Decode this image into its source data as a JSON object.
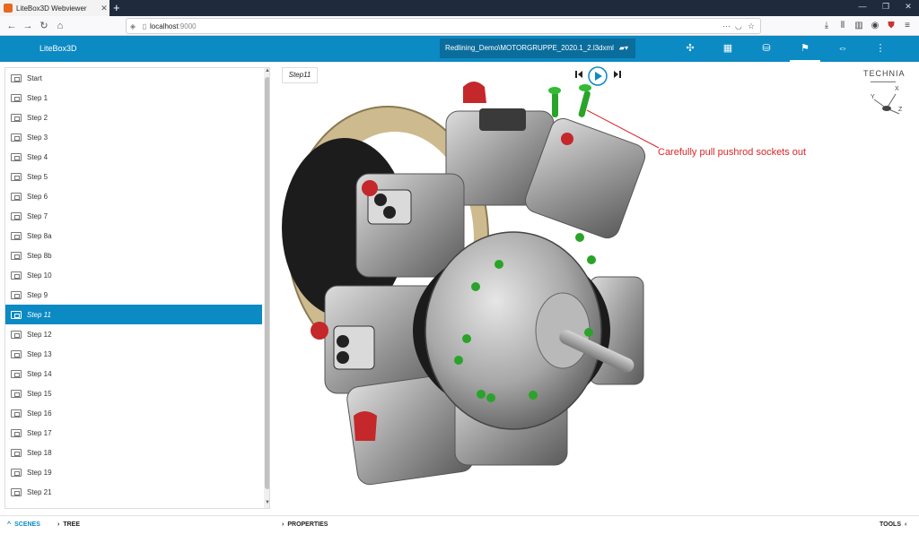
{
  "browser": {
    "tab_title": "LiteBox3D Webviewer",
    "url_host": "localhost",
    "url_port": ":9000"
  },
  "app": {
    "brand": "LiteBox3D",
    "file": "Redlining_Demo\\MOTORGRUPPE_2020.1_2.l3dxml"
  },
  "steps": [
    {
      "label": "Start"
    },
    {
      "label": "Step 1"
    },
    {
      "label": "Step 2"
    },
    {
      "label": "Step 3"
    },
    {
      "label": "Step 4"
    },
    {
      "label": "Step 5"
    },
    {
      "label": "Step 6"
    },
    {
      "label": "Step 7"
    },
    {
      "label": "Step 8a"
    },
    {
      "label": "Step 8b"
    },
    {
      "label": "Step 10"
    },
    {
      "label": "Step 9"
    },
    {
      "label": "Step 11",
      "selected": true
    },
    {
      "label": "Step 12"
    },
    {
      "label": "Step 13"
    },
    {
      "label": "Step 14"
    },
    {
      "label": "Step 15"
    },
    {
      "label": "Step 16"
    },
    {
      "label": "Step 17"
    },
    {
      "label": "Step 18"
    },
    {
      "label": "Step 19"
    },
    {
      "label": "Step 21"
    }
  ],
  "viewer": {
    "current_step": "Step11",
    "annotation": "Carefully pull pushrod sockets out",
    "logo": "TECHNIA",
    "axis_x": "X",
    "axis_y": "Y",
    "axis_z": "Z"
  },
  "bottom": {
    "scenes": "SCENES",
    "tree": "TREE",
    "properties": "PROPERTIES",
    "tools": "TOOLS"
  },
  "colors": {
    "accent": "#0b8ac4",
    "annotation": "#d8262a",
    "socket_green": "#2aa32a",
    "part_red": "#c4282b"
  }
}
